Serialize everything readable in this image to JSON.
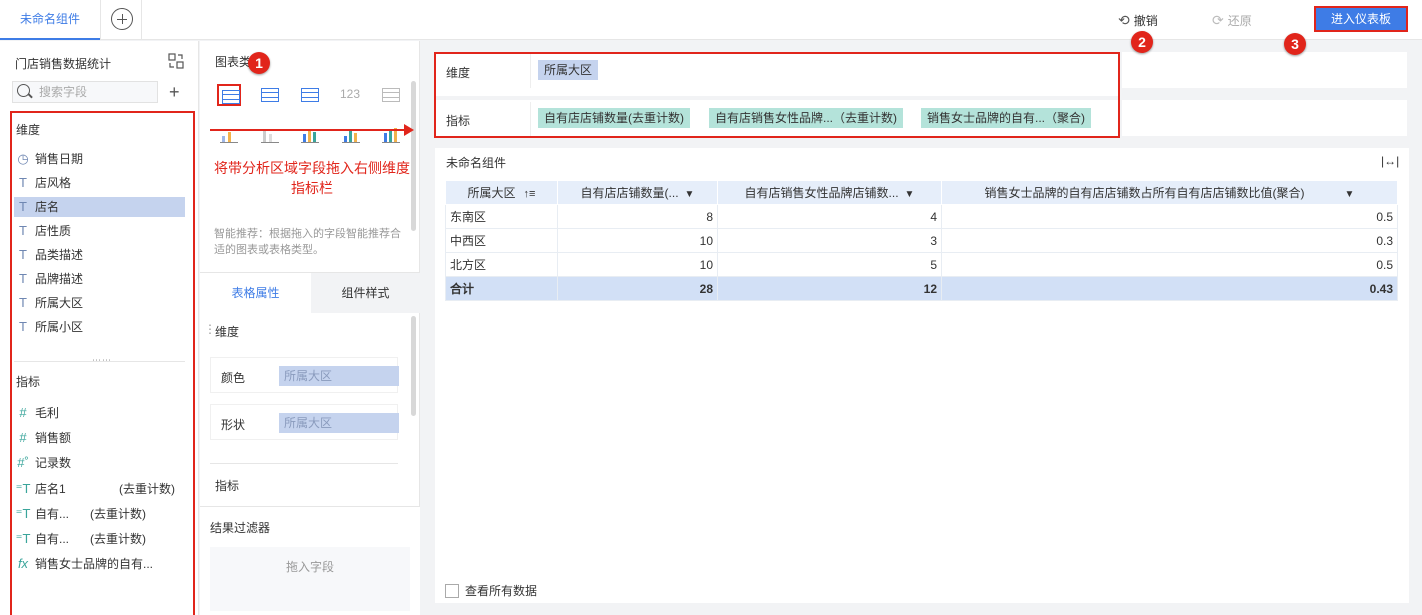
{
  "tabs": {
    "active": "未命名组件"
  },
  "toolbar": {
    "undo": "撤销",
    "redo": "还原",
    "enter_dashboard": "进入仪表板"
  },
  "badges": [
    "1",
    "2",
    "3"
  ],
  "left": {
    "dataset_title": "门店销售数据统计",
    "search_placeholder": "搜索字段",
    "dimension_label": "维度",
    "dimensions": [
      "销售日期",
      "店风格",
      "店名",
      "店性质",
      "品类描述",
      "品牌描述",
      "所属大区",
      "所属小区"
    ],
    "measure_label": "指标",
    "measures": [
      "毛利",
      "销售额",
      "记录数",
      "店名1",
      "自有...",
      "自有...",
      "销售女士品牌的自有..."
    ],
    "measure_notes": [
      "(去重计数)",
      "(去重计数)",
      "(去重计数)"
    ]
  },
  "mid": {
    "chart_type_title": "图表类",
    "hint": "将带分析区域字段拖入右侧维度指标栏",
    "smart_hint": "智能推荐：根据拖入的字段智能推荐合适的图表或表格类型。",
    "tab_table_props": "表格属性",
    "tab_component_style": "组件样式",
    "dimension_label": "维度",
    "color_label": "颜色",
    "color_value": "所属大区",
    "shape_label": "形状",
    "shape_value": "所属大区",
    "measure_label": "指标",
    "filter_title": "结果过滤器",
    "drop_field": "拖入字段"
  },
  "right": {
    "dim_label": "维度",
    "dim_chip": "所属大区",
    "mea_label": "指标",
    "mea_chips": [
      "自有店店铺数量(去重计数)",
      "自有店销售女性品牌...（去重计数)",
      "销售女士品牌的自有...（聚合)"
    ],
    "component_title": "未命名组件",
    "fit_icon": "|↔|",
    "show_all": "查看所有数据"
  },
  "table": {
    "headers": [
      "所属大区",
      "自有店店铺数量(...",
      "自有店销售女性品牌店铺数...",
      "销售女士品牌的自有店店铺数占所有自有店店铺数比值(聚合)"
    ],
    "rows": [
      [
        "东南区",
        "8",
        "4",
        "0.5"
      ],
      [
        "中西区",
        "10",
        "3",
        "0.3"
      ],
      [
        "北方区",
        "10",
        "5",
        "0.5"
      ]
    ],
    "total": [
      "合计",
      "28",
      "12",
      "0.43"
    ]
  },
  "colors": {
    "accent": "#3e7ce6",
    "annotation_red": "#e1251b",
    "dimension_chip": "#c5d3ee",
    "measure_chip": "#b4e3da"
  }
}
